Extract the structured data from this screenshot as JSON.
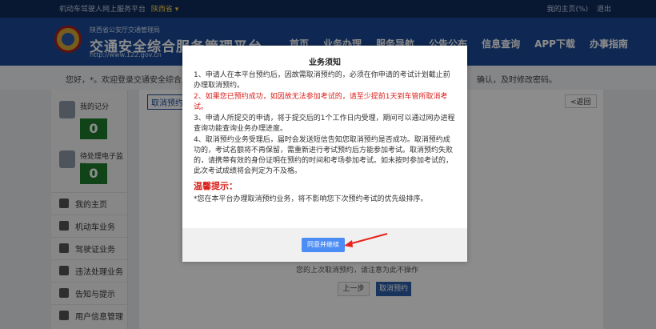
{
  "topbar": {
    "site_label": "机动车驾驶人网上服务平台",
    "province": "陕西省 ▾",
    "links": [
      "我的主页(%)",
      "退出"
    ]
  },
  "header": {
    "sub": "陕西省公安厅交通管理局",
    "title": "交通安全综合服务管理平台",
    "url": "http://www.122.gov.cn",
    "nav": [
      "首页",
      "业务办理",
      "服务导航",
      "公告公布",
      "信息查询",
      "APP下载",
      "办事指南"
    ]
  },
  "notice": {
    "left": "您好，*。欢迎登录交通安全综合服务管理平台",
    "right": "确认，及时修改密码。"
  },
  "sidebar": {
    "stats": [
      {
        "label": "我的记分",
        "count": "0"
      },
      {
        "label": "待处理电子监控",
        "count": "0"
      }
    ],
    "menu": [
      "我的主页",
      "机动车业务",
      "驾驶证业务",
      "违法处理业务",
      "告知与提示",
      "用户信息管理"
    ]
  },
  "main": {
    "tab": "取消预约",
    "back": "<返回",
    "hint": "您的上次取消预约，请注意为此不操作",
    "prev": "上一步",
    "confirm": "取消预约"
  },
  "modal": {
    "title": "业务须知",
    "item1_a": "1、申请人在本平台预约后，因故需取消预约的，必须在你申请的考试计划截止前",
    "item1_b": "办理取消预约。",
    "item2": "2、如果您已预约成功，如因故无法参加考试的，请至少提前1天到车管所取消考试。",
    "item3": "3、申请人所提交的申请，将于提交后的1个工作日内受理，期间可以通过网办进程查询功能查询业务办理进度。",
    "item4": "4、取消预约业务受理后，届时会发送短信告知您取消预约是否成功。取消预约成功的，考试名额将不再保留，需重新进行考试预约后方能参加考试。取消预约失败的，请携带有效的身份证明在预约的时间和考场参加考试。如未按时参加考试的，此次考试成绩将会判定为不及格。",
    "tip_title": "温馨提示：",
    "tip_text": "*您在本平台办理取消预约业务，将不影响您下次预约考试的优先级排序。",
    "ok_button": "同意并继续"
  },
  "colors": {
    "header_bg": "#1a4a97",
    "topbar_bg": "#0f2b5c",
    "count_green": "#1f7a2c",
    "warning_red": "#d9201c",
    "button_blue": "#4b8cf5"
  }
}
